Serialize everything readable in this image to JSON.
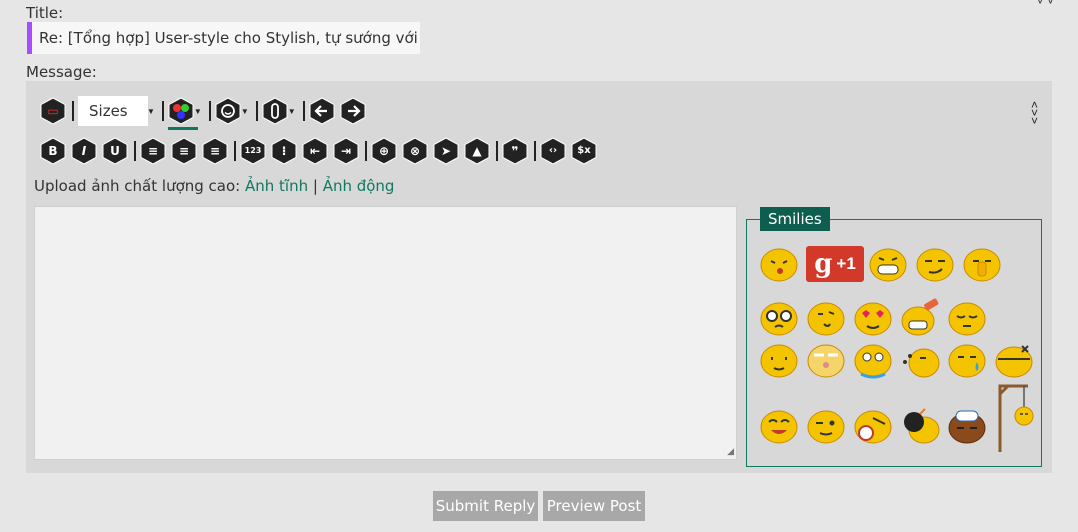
{
  "form": {
    "title_label": "Title:",
    "title_value": "Re: [Tổng hợp] User-style cho Stylish, tự sướng với nhữ",
    "message_label": "Message:",
    "top_right_mark": "˅   ˅"
  },
  "toolbar": {
    "sizes_label": "Sizes",
    "row1_icons": [
      "eraser-icon",
      "color-icon",
      "smiley-icon",
      "attachment-icon",
      "undo-icon",
      "redo-icon"
    ],
    "row2_icons": [
      {
        "name": "bold-icon",
        "glyph": "B"
      },
      {
        "name": "italic-icon",
        "glyph": "I"
      },
      {
        "name": "underline-icon",
        "glyph": "U"
      },
      {
        "name": "align-left-icon",
        "glyph": "≡"
      },
      {
        "name": "align-center-icon",
        "glyph": "≡"
      },
      {
        "name": "align-right-icon",
        "glyph": "≡"
      },
      {
        "name": "ordered-list-icon",
        "glyph": "123"
      },
      {
        "name": "unordered-list-icon",
        "glyph": "⁝"
      },
      {
        "name": "outdent-icon",
        "glyph": "⇤"
      },
      {
        "name": "indent-icon",
        "glyph": "⇥"
      },
      {
        "name": "link-icon",
        "glyph": "⊕"
      },
      {
        "name": "unlink-icon",
        "glyph": "⊗"
      },
      {
        "name": "send-icon",
        "glyph": "➤"
      },
      {
        "name": "image-icon",
        "glyph": "▲"
      },
      {
        "name": "quote-icon",
        "glyph": "❞"
      },
      {
        "name": "code-icon",
        "glyph": "‹›"
      },
      {
        "name": "clear-format-icon",
        "glyph": "$x"
      }
    ],
    "collapse_icon": "chevrons-up-down-icon"
  },
  "upload": {
    "prefix": "Upload ảnh chất lượng cao: ",
    "link_static": "Ảnh tĩnh",
    "divider": " | ",
    "link_animated": "Ảnh động"
  },
  "smilies": {
    "title": "Smilies",
    "gplus_g": "g",
    "gplus_text": "+1",
    "face_color": "#f5c400"
  },
  "buttons": {
    "submit": "Submit Reply",
    "preview": "Preview Post"
  }
}
